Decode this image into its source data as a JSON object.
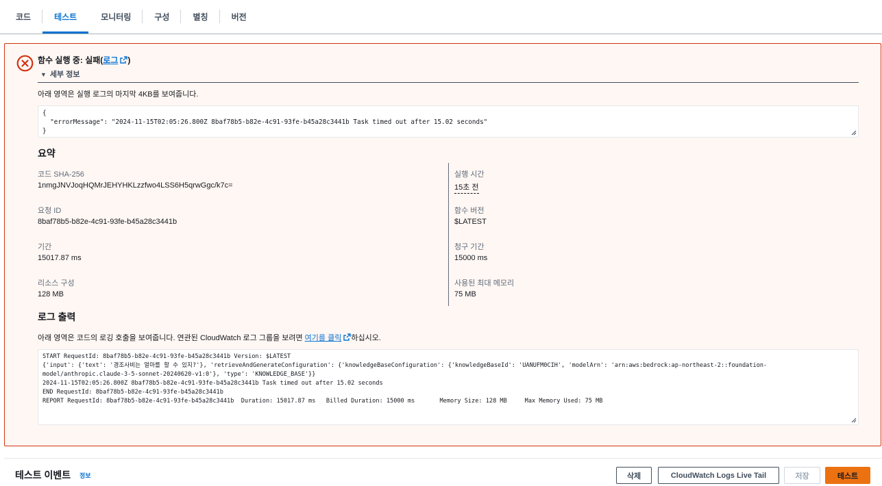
{
  "tabs": [
    {
      "label": "코드",
      "active": false
    },
    {
      "label": "테스트",
      "active": true
    },
    {
      "label": "모니터링",
      "active": false
    },
    {
      "label": "구성",
      "active": false
    },
    {
      "label": "별칭",
      "active": false
    },
    {
      "label": "버전",
      "active": false
    }
  ],
  "error_panel": {
    "title_prefix": "함수 실행 중: 실패(",
    "title_link": "로그",
    "title_suffix": ")",
    "details_label": "세부 정보",
    "note": "아래 영역은 실행 로그의 마지막 4KB를 보여줍니다.",
    "error_json_lines": [
      "{",
      "  \"errorMessage\": \"2024-11-15T02:05:26.800Z 8baf78b5-b82e-4c91-93fe-b45a28c3441b Task timed out after 15.02 seconds\"",
      "}"
    ]
  },
  "summary": {
    "heading": "요약",
    "left": [
      {
        "label": "코드 SHA-256",
        "value": "1nmgJNVJoqHQMrJEHYHKLzzfwo4LSS6H5qrwGgc/k7c="
      },
      {
        "label": "요청 ID",
        "value": "8baf78b5-b82e-4c91-93fe-b45a28c3441b"
      },
      {
        "label": "기간",
        "value": "15017.87 ms"
      },
      {
        "label": "리소스 구성",
        "value": "128 MB"
      }
    ],
    "right": [
      {
        "label": "실행 시간",
        "value": "15초 전"
      },
      {
        "label": "함수 버전",
        "value": "$LATEST"
      },
      {
        "label": "청구 기간",
        "value": "15000 ms"
      },
      {
        "label": "사용된 최대 메모리",
        "value": "75 MB"
      }
    ]
  },
  "log_output": {
    "heading": "로그 출력",
    "note_prefix": "아래 영역은 코드의 로깅 호출을 보여줍니다. 연관된 CloudWatch 로그 그룹을 보려면 ",
    "note_link": "여기를 클릭",
    "note_suffix": "하십시오.",
    "lines": [
      "START RequestId: 8baf78b5-b82e-4c91-93fe-b45a28c3441b Version: $LATEST",
      "{'input': {'text': '경조사비는 얼마를 할 수 있지?'}, 'retrieveAndGenerateConfiguration': {'knowledgeBaseConfiguration': {'knowledgeBaseId': 'UANUFM0CIH', 'modelArn': 'arn:aws:bedrock:ap-northeast-2::foundation-",
      "model/anthropic.claude-3-5-sonnet-20240620-v1:0'}, 'type': 'KNOWLEDGE_BASE'}}",
      "2024-11-15T02:05:26.800Z 8baf78b5-b82e-4c91-93fe-b45a28c3441b Task timed out after 15.02 seconds",
      "",
      "END RequestId: 8baf78b5-b82e-4c91-93fe-b45a28c3441b",
      "REPORT RequestId: 8baf78b5-b82e-4c91-93fe-b45a28c3441b  Duration: 15017.87 ms   Billed Duration: 15000 ms       Memory Size: 128 MB     Max Memory Used: 75 MB"
    ]
  },
  "test_event": {
    "title": "테스트 이벤트",
    "info_link": "정보",
    "buttons": {
      "delete": "삭제",
      "live_tail": "CloudWatch Logs Live Tail",
      "save": "저장",
      "test": "테스트"
    }
  },
  "colors": {
    "accent": "#0972d3",
    "error": "#d13212",
    "error_bg": "#fff7f3",
    "primary_button": "#ec7211"
  }
}
